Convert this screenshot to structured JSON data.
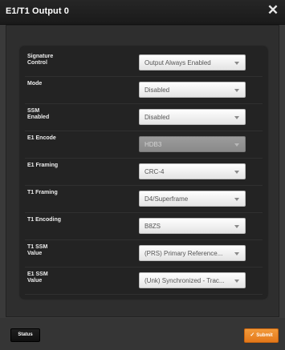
{
  "dialog": {
    "title": "E1/T1 Output 0",
    "close_glyph": "✕"
  },
  "form": {
    "rows": [
      {
        "label": "Signature\nControl",
        "value": "Output Always Enabled",
        "disabled": false
      },
      {
        "label": "Mode",
        "value": "Disabled",
        "disabled": false
      },
      {
        "label": "SSM\nEnabled",
        "value": "Disabled",
        "disabled": false
      },
      {
        "label": "E1 Encode",
        "value": "HDB3",
        "disabled": true
      },
      {
        "label": "E1 Framing",
        "value": "CRC-4",
        "disabled": false
      },
      {
        "label": "T1 Framing",
        "value": "D4/Superframe",
        "disabled": false
      },
      {
        "label": "T1 Encoding",
        "value": "B8ZS",
        "disabled": false
      },
      {
        "label": "T1 SSM\nValue",
        "value": "(PRS) Primary Reference...",
        "disabled": false
      },
      {
        "label": "E1 SSM\nValue",
        "value": "(Unk) Synchronized - Trac...",
        "disabled": false
      }
    ]
  },
  "footer": {
    "status_label": "Status",
    "submit_label": "Submit",
    "submit_icon": "check-icon"
  },
  "colors": {
    "submit_accent": "#f0912e",
    "panel_background": "#232323"
  }
}
